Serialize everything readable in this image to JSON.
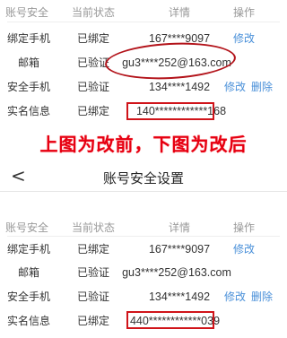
{
  "before": {
    "headers": {
      "type": "账号安全",
      "state": "当前状态",
      "detail": "详情",
      "op": "操作"
    },
    "rows": [
      {
        "type": "绑定手机",
        "state": "已绑定",
        "detail": "167****9097",
        "op": "修改",
        "del": ""
      },
      {
        "type": "邮箱",
        "state": "已验证",
        "detail": "gu3****252@163.com",
        "op": "",
        "del": ""
      },
      {
        "type": "安全手机",
        "state": "已验证",
        "detail": "134****1492",
        "op": "修改",
        "del": "删除"
      },
      {
        "type": "实名信息",
        "state": "已绑定",
        "detail": "140************168",
        "op": "",
        "del": ""
      }
    ]
  },
  "banner": "上图为改前，下图为改后",
  "nav": {
    "back": "<",
    "title": "账号安全设置"
  },
  "after": {
    "headers": {
      "type": "账号安全",
      "state": "当前状态",
      "detail": "详情",
      "op": "操作"
    },
    "rows": [
      {
        "type": "绑定手机",
        "state": "已绑定",
        "detail": "167****9097",
        "op": "修改",
        "del": ""
      },
      {
        "type": "邮箱",
        "state": "已验证",
        "detail": "gu3****252@163.com",
        "op": "",
        "del": ""
      },
      {
        "type": "安全手机",
        "state": "已验证",
        "detail": "134****1492",
        "op": "修改",
        "del": "删除"
      },
      {
        "type": "实名信息",
        "state": "已绑定",
        "detail": "440************039",
        "op": "",
        "del": ""
      }
    ]
  },
  "colors": {
    "link": "#4a90d9",
    "annotation": "#d0141a",
    "banner": "#e60012"
  }
}
